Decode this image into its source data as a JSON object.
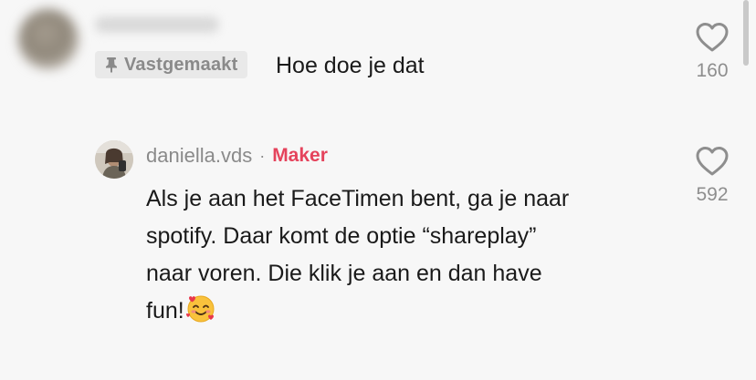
{
  "pinned_comment": {
    "pinned_label": "Vastgemaakt",
    "text": "Hoe doe je dat",
    "like_count": "160",
    "icons": {
      "pin": "pin-icon",
      "like": "heart-outline-icon"
    }
  },
  "reply": {
    "username": "daniella.vds",
    "separator": "·",
    "creator_label": "Maker",
    "text_lines": [
      "Als je aan het FaceTimen bent, ga je naar",
      "spotify. Daar komt de optie “shareplay”",
      "naar voren. Die klik je aan en dan have",
      "fun!"
    ],
    "emoji": "smiling-face-with-hearts",
    "like_count": "592",
    "icons": {
      "like": "heart-outline-icon"
    }
  },
  "colors": {
    "background": "#f7f7f7",
    "creator_accent": "#e5435c",
    "muted_text": "#8a8a8a",
    "primary_text": "#1a1a1a"
  }
}
